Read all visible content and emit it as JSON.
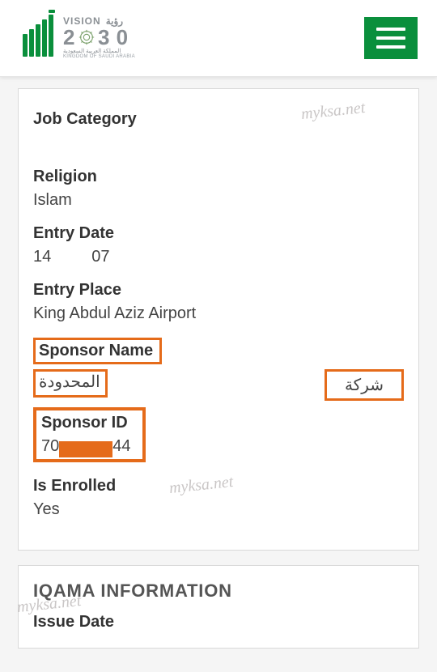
{
  "header": {
    "vision_en": "VISION",
    "vision_ar": "رؤية",
    "year_2": "2",
    "year_30": "3 0",
    "tagline_ar": "المملكة العربية السعودية",
    "tagline_en": "KINGDOM OF SAUDI ARABIA"
  },
  "watermark": "myksa.net",
  "details": {
    "job_category_label": "Job Category",
    "religion_label": "Religion",
    "religion_value": "Islam",
    "entry_date_label": "Entry Date",
    "entry_date_day": "14",
    "entry_date_month": "07",
    "entry_place_label": "Entry Place",
    "entry_place_value": "King Abdul Aziz Airport",
    "sponsor_name_label": "Sponsor Name",
    "sponsor_name_left": "المحدودة",
    "sponsor_name_right": "شركة",
    "sponsor_id_label": "Sponsor ID",
    "sponsor_id_prefix": "70",
    "sponsor_id_suffix": "44",
    "is_enrolled_label": "Is Enrolled",
    "is_enrolled_value": "Yes"
  },
  "iqama": {
    "section_title": "IQAMA INFORMATION",
    "issue_date_label": "Issue Date"
  },
  "colors": {
    "highlight": "#e56b1a",
    "brand_green": "#0a8f3c"
  }
}
